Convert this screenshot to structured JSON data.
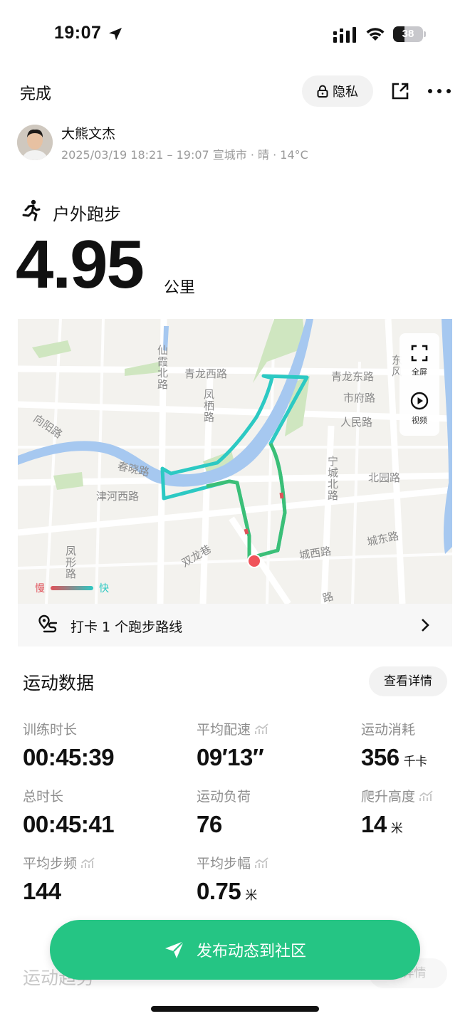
{
  "status_bar": {
    "time": "19:07",
    "battery": "38",
    "battery_level": 0.38
  },
  "header": {
    "done_label": "完成",
    "privacy_label": "隐私"
  },
  "user": {
    "name": "大熊文杰",
    "meta": "2025/03/19 18:21 – 19:07 宣城市 · 晴 · 14°C"
  },
  "activity": {
    "type": "户外跑步",
    "distance": "4.95",
    "distance_unit": "公里"
  },
  "map": {
    "labels": {
      "xianhe": "仙霞北路",
      "qinglong_west": "青龙西路",
      "qinglong_east": "青龙东路",
      "dongfeng": "东风",
      "fengqi": "凤栖路",
      "shifu": "市府路",
      "renmin": "人民路",
      "xiangyang": "向阳路",
      "chunxiao": "春晓路",
      "ningcheng": "宁城北路",
      "beiyuan": "北园路",
      "jinhe": "津河西路",
      "chengdong": "城东路",
      "chengxi": "城西路",
      "shuanglong": "双龙巷",
      "fengxing": "凤形路",
      "lu": "路"
    },
    "fullscreen_label": "全屏",
    "video_label": "视频",
    "legend_slow": "慢",
    "legend_fast": "快",
    "colors": {
      "slow": "#e0525a",
      "fast": "#2cc9c3",
      "river": "#a6c8f0",
      "green": "#cfe6c0"
    }
  },
  "checkin": {
    "text": "打卡 1 个跑步路线"
  },
  "stats": {
    "title": "运动数据",
    "details_label": "查看详情",
    "items": [
      {
        "label": "训练时长",
        "value": "00:45:39",
        "unit": ""
      },
      {
        "label": "平均配速",
        "value": "09′13″",
        "unit": ""
      },
      {
        "label": "运动消耗",
        "value": "356",
        "unit": "千卡"
      },
      {
        "label": "总时长",
        "value": "00:45:41",
        "unit": ""
      },
      {
        "label": "运动负荷",
        "value": "76",
        "unit": ""
      },
      {
        "label": "爬升高度",
        "value": "14",
        "unit": "米"
      },
      {
        "label": "平均步频",
        "value": "144",
        "unit": ""
      },
      {
        "label": "平均步幅",
        "value": "0.75",
        "unit": "米"
      }
    ]
  },
  "behind": {
    "title": "运动趋势",
    "details_label": "看详情"
  },
  "publish": {
    "label": "发布动态到社区"
  },
  "accent_color": "#25c584"
}
